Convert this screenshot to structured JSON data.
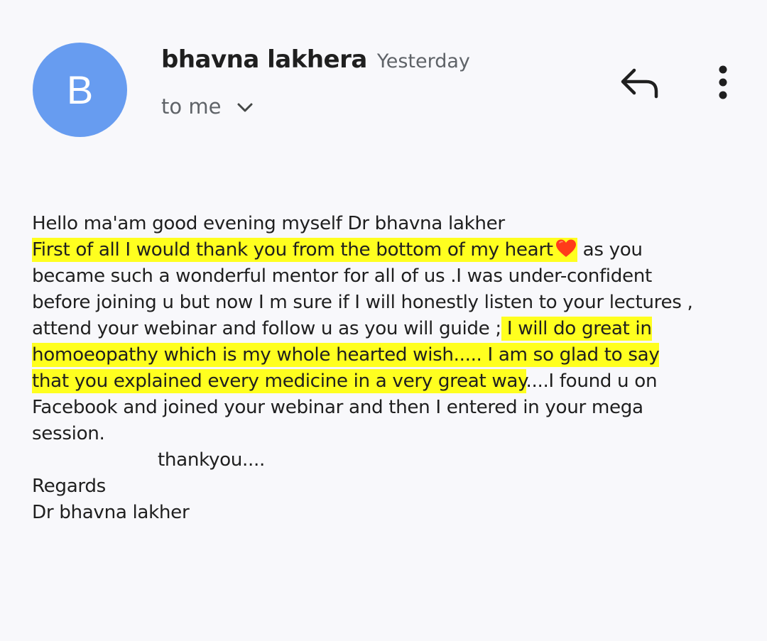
{
  "header": {
    "avatar_letter": "B",
    "sender_name": "bhavna lakhera",
    "time": "Yesterday",
    "recipient": "to me",
    "avatar_color": "#679cf0"
  },
  "actions": {
    "reply_icon": "reply-icon",
    "more_icon": "more-vertical-icon"
  },
  "body": {
    "line1": "Hello ma'am good evening myself Dr bhavna lakher",
    "line2_highlight": "First of all I would thank you from the bottom of my heart",
    "line2_rest": " as you",
    "line3": "became such a wonderful mentor for all of us .I was under-confident",
    "line4": "before joining u but now I m sure if I will honestly listen to your lectures ,",
    "line5_plain": "attend your webinar and follow u as you will guide ;",
    "line5_highlight": " I will do great in ",
    "line6_highlight": "homoeopathy which is my whole hearted wish..... I am so glad to say ",
    "line7_highlight": "that you explained every medicine in a very great way",
    "line7_rest": "....I found u on",
    "line8": "Facebook and joined your webinar and then I entered in your mega",
    "line9": "session.",
    "line10": "thankyou....",
    "line11": "Regards",
    "line12": "Dr bhavna lakher",
    "highlight_color": "#ffff1f",
    "heart_icon": "red-heart-icon"
  }
}
